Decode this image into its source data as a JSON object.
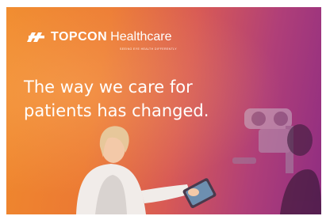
{
  "brand": {
    "name": "TOPCON",
    "suffix": "Healthcare",
    "tagline": "SEEING EYE HEALTH DIFFERENTLY"
  },
  "headline": {
    "line1": "The way we care for",
    "line2": "patients has changed."
  },
  "colors": {
    "gradient_start": "#f08a2c",
    "gradient_end": "#8f2d82",
    "text": "#ffffff"
  }
}
